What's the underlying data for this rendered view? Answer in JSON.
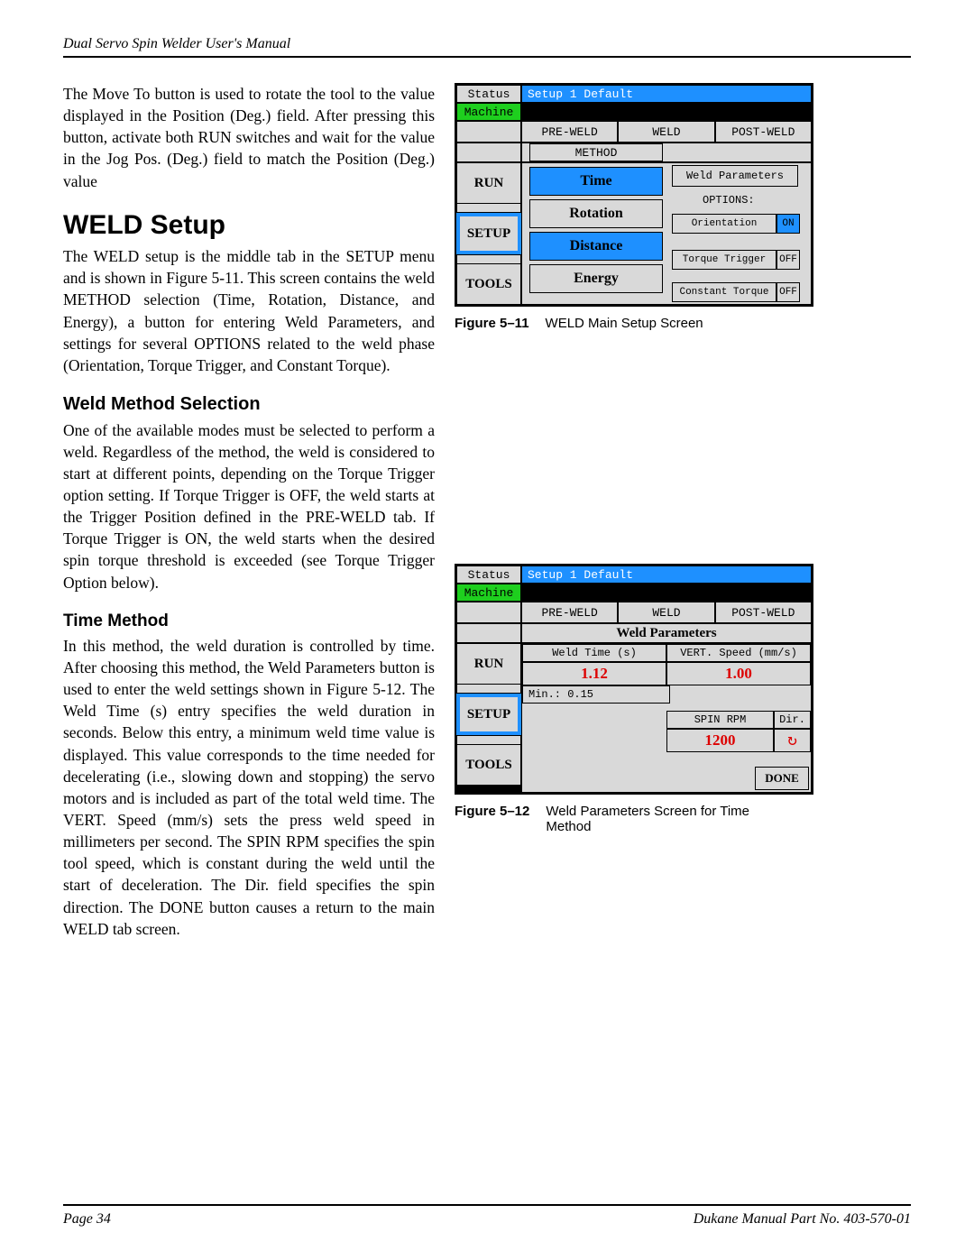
{
  "header": {
    "title": "Dual Servo Spin Welder User's Manual"
  },
  "footer": {
    "left": "Page   34",
    "right": "Dukane Manual Part No. 403-570-01"
  },
  "body": {
    "intro_para": "The Move To button is used to rotate the tool to the value displayed in the Position (Deg.) field. After pressing this button, activate both RUN switches and wait for the value in the Jog Pos. (Deg.) field to match the Position (Deg.) value",
    "weld_setup_heading": "WELD Setup",
    "weld_setup_para": "The WELD setup is the middle tab in the SETUP menu and is shown in Figure 5-11. This screen contains the weld METHOD selection (Time, Rotation, Distance, and Energy), a button for entering Weld Parameters, and settings for several OPTIONS related to the weld phase (Orientation, Torque Trigger, and Constant Torque).",
    "weld_method_heading": "Weld Method Selection",
    "weld_method_para": "One of the available modes must be selected to perform a weld. Regardless of the method, the weld is considered to start at different points, depending on the Torque Trigger option setting. If Torque Trigger is OFF, the weld starts at the Trigger Position defined in the PRE-WELD tab. If Torque Trigger is ON, the weld starts when the desired spin torque threshold is exceeded (see Torque Trigger Option below).",
    "time_method_heading": "Time Method",
    "time_method_para": "In this method, the weld duration is controlled by time. After choosing this method, the Weld Parameters button is used to enter the weld settings shown in Figure 5-12. The Weld Time (s) entry specifies the weld duration in seconds.  Below this entry, a minimum weld time value is displayed. This value corresponds to the time needed for decelerating (i.e., slowing down and stopping) the servo motors and is included as part of the total weld time. The VERT. Speed (mm/s) sets the press weld speed in millimeters per second. The SPIN RPM specifies the spin tool speed, which is constant during the weld until the start of deceleration. The Dir. field specifies the spin direction. The DONE button causes a return to the main WELD tab screen."
  },
  "fig11": {
    "label": "Figure 5–11",
    "caption": "WELD Main Setup Screen",
    "screen": {
      "status": "Status",
      "machine": "Machine",
      "titlebar": "Setup 1    Default",
      "tabs": [
        "PRE-WELD",
        "WELD",
        "POST-WELD"
      ],
      "method_label": "METHOD",
      "nav": {
        "run": "RUN",
        "setup": "SETUP",
        "tools": "TOOLS"
      },
      "methods": [
        "Time",
        "Rotation",
        "Distance",
        "Energy"
      ],
      "weld_params_btn": "Weld Parameters",
      "options_label": "OPTIONS:",
      "options": [
        {
          "name": "Orientation",
          "value": "ON"
        },
        {
          "name": "Torque Trigger",
          "value": "OFF"
        },
        {
          "name": "Constant Torque",
          "value": "OFF"
        }
      ]
    }
  },
  "fig12": {
    "label": "Figure 5–12",
    "caption": "Weld Parameters Screen for Time Method",
    "screen": {
      "status": "Status",
      "machine": "Machine",
      "titlebar": "Setup 1    Default",
      "tabs": [
        "PRE-WELD",
        "WELD",
        "POST-WELD"
      ],
      "wp_title": "Weld Parameters",
      "nav": {
        "run": "RUN",
        "setup": "SETUP",
        "tools": "TOOLS"
      },
      "weld_time_label": "Weld Time (s)",
      "weld_time_value": "1.12",
      "min_label": "Min.:    0.15",
      "vert_speed_label": "VERT. Speed (mm/s)",
      "vert_speed_value": "1.00",
      "spin_rpm_label": "SPIN RPM",
      "spin_rpm_value": "1200",
      "dir_label": "Dir.",
      "done": "DONE"
    }
  }
}
